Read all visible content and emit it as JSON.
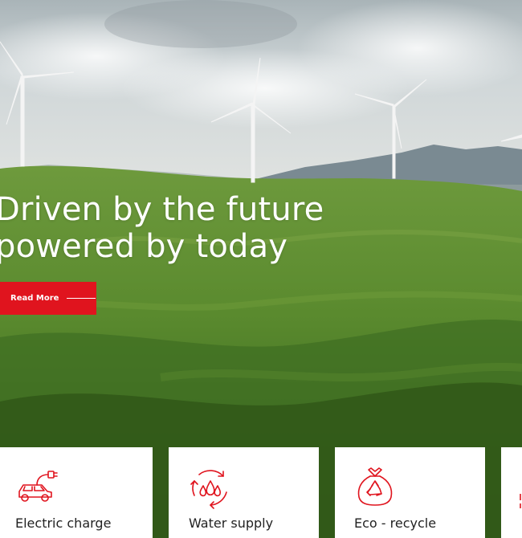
{
  "hero": {
    "title_line1": "Driven by the future",
    "title_line2": "powered by today",
    "read_more_label": "Read More"
  },
  "services": [
    {
      "label": "Electric charge",
      "icon": "electric-car-plug-icon"
    },
    {
      "label": "Water supply",
      "icon": "water-drops-cycle-icon"
    },
    {
      "label": "Eco - recycle",
      "icon": "recycle-bag-icon"
    },
    {
      "label": "",
      "icon": "partial-icon"
    }
  ],
  "colors": {
    "accent": "#e0141e",
    "sky": "#c9d3d8",
    "hills": "#4f7f2a",
    "card_bg": "#ffffff"
  }
}
